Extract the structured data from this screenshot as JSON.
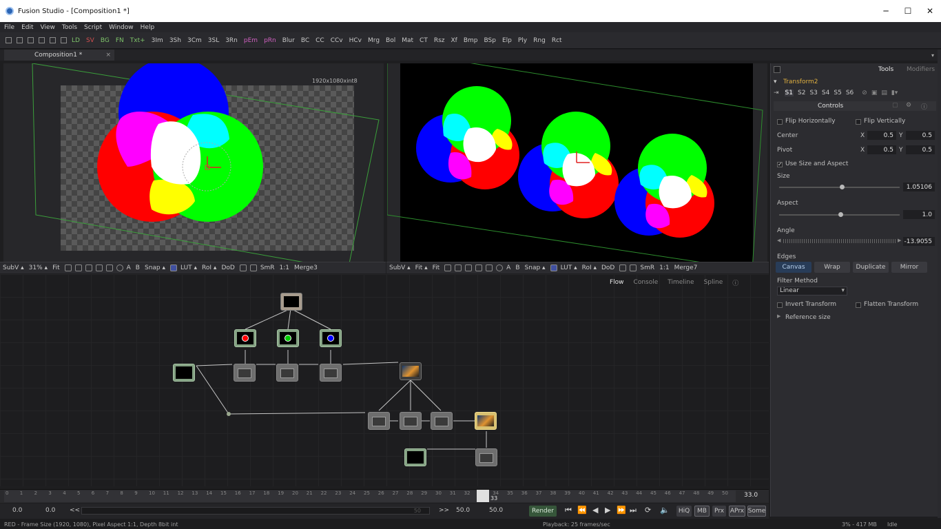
{
  "window": {
    "title": "Fusion Studio - [Composition1 *]",
    "minimize": "─",
    "maximize": "☐",
    "close": "✕"
  },
  "menu": [
    "File",
    "Edit",
    "View",
    "Tools",
    "Script",
    "Window",
    "Help"
  ],
  "toolbar": [
    {
      "label": "LD",
      "color": "#7ec46a"
    },
    {
      "label": "SV",
      "color": "#d35050"
    },
    {
      "label": "BG",
      "color": "#7ec46a"
    },
    {
      "label": "FN",
      "color": "#7ec46a"
    },
    {
      "label": "Txt+",
      "color": "#7ec46a"
    },
    {
      "label": "3Im",
      "color": "#c8c8c8"
    },
    {
      "label": "3Sh",
      "color": "#c8c8c8"
    },
    {
      "label": "3Cm",
      "color": "#c8c8c8"
    },
    {
      "label": "3SL",
      "color": "#c8c8c8"
    },
    {
      "label": "3Rn",
      "color": "#c8c8c8"
    },
    {
      "label": "pEm",
      "color": "#d060c0"
    },
    {
      "label": "pRn",
      "color": "#d060c0"
    },
    {
      "label": "Blur",
      "color": "#c8c8c8"
    },
    {
      "label": "BC",
      "color": "#c8c8c8"
    },
    {
      "label": "CC",
      "color": "#c8c8c8"
    },
    {
      "label": "CCv",
      "color": "#c8c8c8"
    },
    {
      "label": "HCv",
      "color": "#c8c8c8"
    },
    {
      "label": "Mrg",
      "color": "#c8c8c8"
    },
    {
      "label": "Bol",
      "color": "#c8c8c8"
    },
    {
      "label": "Mat",
      "color": "#c8c8c8"
    },
    {
      "label": "CT",
      "color": "#c8c8c8"
    },
    {
      "label": "Rsz",
      "color": "#c8c8c8"
    },
    {
      "label": "Xf",
      "color": "#c8c8c8"
    },
    {
      "label": "Bmp",
      "color": "#c8c8c8"
    },
    {
      "label": "BSp",
      "color": "#c8c8c8"
    },
    {
      "label": "Elp",
      "color": "#c8c8c8"
    },
    {
      "label": "Ply",
      "color": "#c8c8c8"
    },
    {
      "label": "Rng",
      "color": "#c8c8c8"
    },
    {
      "label": "Rct",
      "color": "#c8c8c8"
    }
  ],
  "comp_tab": {
    "label": "Composition1 *",
    "close": "×"
  },
  "viewer1": {
    "resolution": "1920x1080xint8",
    "subv": "SubV ▴",
    "zoom": "31% ▴",
    "fit": "Fit",
    "snap": "Snap ▴",
    "lut": "LUT ▴",
    "roi": "RoI ▴",
    "dod": "DoD",
    "smr": "SmR",
    "ratio": "1:1",
    "node": "Merge3",
    "a": "A",
    "b": "B"
  },
  "viewer2": {
    "subv": "SubV ▴",
    "zoom": "Fit ▴",
    "fit": "Fit",
    "snap": "Snap ▴",
    "lut": "LUT ▴",
    "roi": "RoI ▴",
    "dod": "DoD",
    "smr": "SmR",
    "ratio": "1:1",
    "node": "Merge7",
    "a": "A",
    "b": "B"
  },
  "flow_tabs": {
    "flow": "Flow",
    "console": "Console",
    "timeline": "Timeline",
    "spline": "Spline"
  },
  "timeline": {
    "ticks": [
      "0",
      "1",
      "2",
      "3",
      "4",
      "5",
      "6",
      "7",
      "8",
      "9",
      "10",
      "11",
      "12",
      "13",
      "14",
      "15",
      "16",
      "17",
      "18",
      "19",
      "20",
      "21",
      "22",
      "23",
      "24",
      "25",
      "26",
      "27",
      "28",
      "29",
      "30",
      "31",
      "32",
      "33",
      "34",
      "35",
      "36",
      "37",
      "38",
      "39",
      "40",
      "41",
      "42",
      "43",
      "44",
      "45",
      "46",
      "47",
      "48",
      "49",
      "50"
    ],
    "playhead": "33",
    "end": "33.0"
  },
  "transport": {
    "start": "0.0",
    "render_start": "0.0",
    "prev": "<<",
    "range_end": "50",
    "next": ">>",
    "render_end": "50.0",
    "end": "50.0",
    "render": "Render",
    "hiq": "HiQ",
    "mb": "MB",
    "prx": "Prx",
    "aprx": "APrx",
    "some": "Some"
  },
  "status": {
    "left": "RED - Frame Size (1920, 1080), Pixel Aspect 1:1, Depth 8bit int",
    "playback": "Playback: 25 frames/sec",
    "memory": "3% - 417 MB",
    "state": "Idle"
  },
  "inspector": {
    "tabs": {
      "tools": "Tools",
      "modifiers": "Modifiers"
    },
    "tool_name": "Transform2",
    "versions": [
      "S1",
      "S2",
      "S3",
      "S4",
      "S5",
      "S6"
    ],
    "section": "Controls",
    "flip_h": "Flip Horizontally",
    "flip_v": "Flip Vertically",
    "center": {
      "label": "Center",
      "x_label": "X",
      "x": "0.5",
      "y_label": "Y",
      "y": "0.5"
    },
    "pivot": {
      "label": "Pivot",
      "x_label": "X",
      "x": "0.5",
      "y_label": "Y",
      "y": "0.5"
    },
    "use_size": "Use Size and Aspect",
    "size": {
      "label": "Size",
      "value": "1.05106",
      "fraction": 0.52
    },
    "aspect": {
      "label": "Aspect",
      "value": "1.0",
      "fraction": 0.51
    },
    "angle": {
      "label": "Angle",
      "value": "-13.9055"
    },
    "edges": {
      "label": "Edges",
      "options": [
        "Canvas",
        "Wrap",
        "Duplicate",
        "Mirror"
      ],
      "selected": "Canvas"
    },
    "filter": {
      "label": "Filter Method",
      "value": "Linear"
    },
    "invert": "Invert Transform",
    "flatten": "Flatten Transform",
    "reference": "Reference size"
  }
}
